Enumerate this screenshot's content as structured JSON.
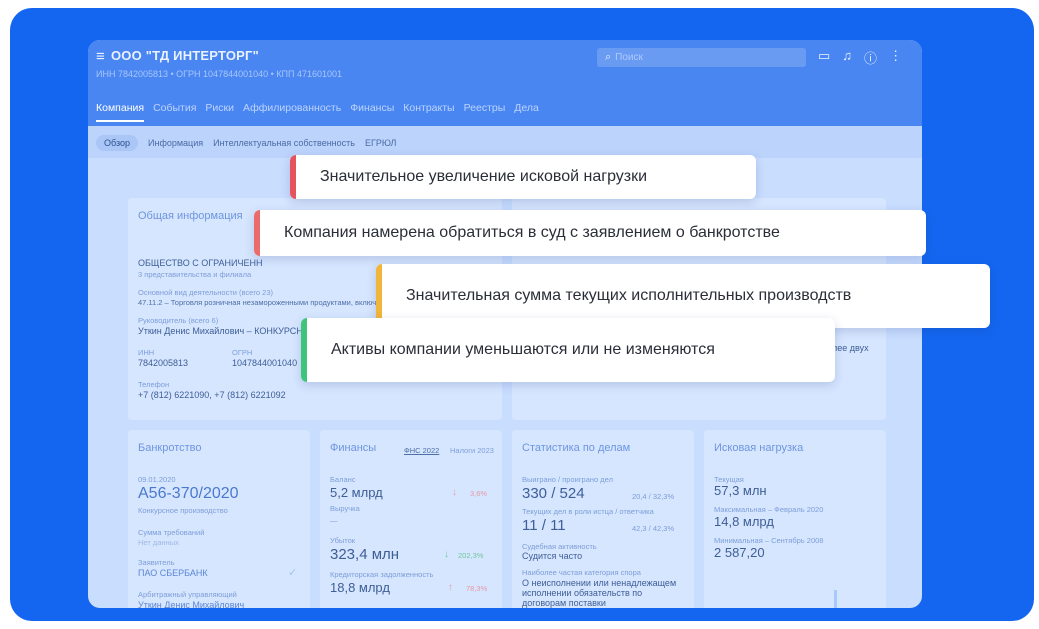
{
  "colors": {
    "background": "#1466f0",
    "toast_red": "#e5535f",
    "toast_red_light": "#eb6b6b",
    "toast_orange": "#f0b53a",
    "toast_green": "#3fc47c"
  },
  "header": {
    "menu_icon": "hamburger-icon",
    "company": "ООО \"ТД ИНТЕРТОРГ\"",
    "ids": "ИНН 7842005813  •  ОГРН 1047844001040  •  КПП 471601001",
    "search_placeholder": "Поиск",
    "icons": [
      "chat-icon",
      "bell-icon",
      "help-icon",
      "more-icon"
    ]
  },
  "tabs": [
    "Компания",
    "События",
    "Риски",
    "Аффилированность",
    "Финансы",
    "Контракты",
    "Реестры",
    "Дела"
  ],
  "subtabs": [
    "Обзор",
    "Информация",
    "Интеллектуальная собственность",
    "ЕГРЮЛ"
  ],
  "general": {
    "title": "Общая информация",
    "org": "ОБЩЕСТВО С ОГРАНИЧЕНН",
    "branches": "3 представительства и филиала",
    "activity_label": "Основной вид деятельности (всего 23)",
    "activity": "47.11.2 – Торговля розничная незамороженными продуктами, включ",
    "head_label": "Руководитель (всего 6)",
    "head": "Уткин Денис Михайлович – КОНКУРСН",
    "inn_label": "ИНН",
    "inn": "7842005813",
    "ogrn_label": "ОГРН",
    "ogrn": "1047844001040",
    "phone_label": "Телефон",
    "phone": "+7 (812) 6221090, +7 (812) 6221092",
    "side_note": "лее двух"
  },
  "bankruptcy": {
    "title": "Банкротство",
    "date": "09.01.2020",
    "case": "А56-370/2020",
    "kind": "Конкурсное производство",
    "claims_label": "Сумма требований",
    "claims": "Нет данных",
    "applicant_label": "Заявитель",
    "applicant": "ПАО СБЕРБАНК",
    "manager_label": "Арбитражный управляющий",
    "manager": "Уткин Денис Михайлович"
  },
  "finance": {
    "title": "Финансы",
    "tab1": "ФНС 2022",
    "tab2": "Налоги 2023",
    "balance_label": "Баланс",
    "balance": "5,2 млрд",
    "balance_change": "3,6%",
    "revenue_label": "Выручка",
    "revenue": "—",
    "loss_label": "Убыток",
    "loss": "323,4 млн",
    "loss_change": "202,3%",
    "debt_label": "Кредиторская задолженность",
    "debt": "18,8 млрд",
    "debt_change": "78,3%"
  },
  "cases": {
    "title": "Статистика по делам",
    "won_label": "Выиграно / проиграно дел",
    "won": "330 / 524",
    "won_pct": "20,4 / 32,3%",
    "current_label": "Текущих дел в роли истца / ответчика",
    "current": "11 / 11",
    "current_pct": "42,3 / 42,3%",
    "activity_label": "Судебная активность",
    "activity": "Судится часто",
    "category_label": "Наиболее частая категория спора",
    "category": "О неисполнении или ненадлежащем исполнении обязательств по договорам поставки"
  },
  "claims_load": {
    "title": "Исковая нагрузка",
    "current_label": "Текущая",
    "current": "57,3 млн",
    "max_label": "Максимальная – Февраль 2020",
    "max": "14,8 млрд",
    "min_label": "Минимальная – Сентябрь 2008",
    "min": "2 587,20"
  },
  "toasts": [
    {
      "text": "Значительное увеличение исковой нагрузки",
      "color": "#e5535f"
    },
    {
      "text": "Компания намерена обратиться в суд с заявлением о банкротстве",
      "color": "#eb6b6b"
    },
    {
      "text": "Значительная сумма текущих исполнительных производств",
      "color": "#f0b53a"
    },
    {
      "text": "Активы компании уменьшаются или не изменяются",
      "color": "#3fc47c"
    }
  ]
}
